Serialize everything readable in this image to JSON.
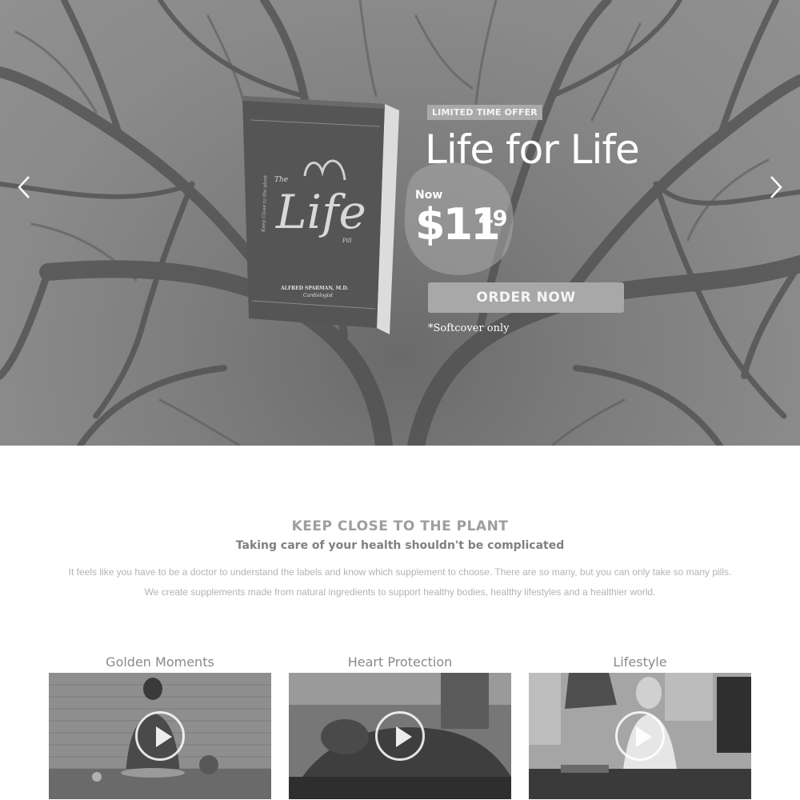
{
  "hero": {
    "badge": "LIMITED TIME OFFER",
    "title": "Life for Life",
    "price_prefix": "Now",
    "price_main": "$11",
    "price_cents": "49",
    "order_button": "ORDER NOW",
    "note": "*Softcover only",
    "book": {
      "the": "The",
      "title": "Life",
      "pill": "Pill",
      "tagline": "Keep Close to the plant",
      "author": "ALFRED SPARMAN, M.D.",
      "author_role": "Cardiologist"
    },
    "icons": {
      "prev": "chevron-left-icon",
      "next": "chevron-right-icon"
    }
  },
  "intro": {
    "heading": "KEEP CLOSE TO THE PLANT",
    "subheading": "Taking care of your health shouldn't be complicated",
    "paragraph1": "It feels like you have to be a doctor to understand the labels and know which supplement to choose. There are so many, but you can only take so many pills.",
    "paragraph2": "We create supplements made from natural ingredients to support healthy bodies, healthy lifestyles and a healthier world."
  },
  "videos": [
    {
      "title": "Golden Moments",
      "icon": "play-icon"
    },
    {
      "title": "Heart Protection",
      "icon": "play-icon"
    },
    {
      "title": "Lifestyle",
      "icon": "play-icon"
    }
  ],
  "colors": {
    "hero_bg": "#7c7c7c",
    "badge_bg": "#a9a9a9",
    "button_bg": "#a8a8a8",
    "heading": "#9e9e9e",
    "subheading": "#808080",
    "body_text": "#b3b3b3"
  }
}
